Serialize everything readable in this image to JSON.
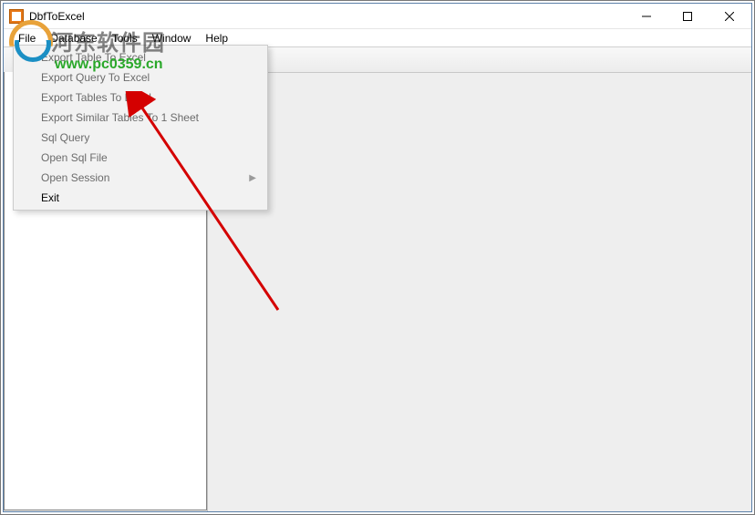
{
  "window": {
    "title": "DbfToExcel"
  },
  "menubar": {
    "items": [
      "File",
      "Database",
      "Tools",
      "Window",
      "Help"
    ]
  },
  "file_menu": {
    "items": [
      {
        "label": "Export Table To Excel",
        "enabled": false,
        "submenu": false
      },
      {
        "label": "Export Query To Excel",
        "enabled": false,
        "submenu": false
      },
      {
        "label": "Export Tables To Excel",
        "enabled": false,
        "submenu": false
      },
      {
        "label": "Export Similar Tables To 1 Sheet",
        "enabled": false,
        "submenu": false
      },
      {
        "label": "Sql Query",
        "enabled": false,
        "submenu": false
      },
      {
        "label": "Open Sql File",
        "enabled": false,
        "submenu": false
      },
      {
        "label": "Open Session",
        "enabled": false,
        "submenu": true
      },
      {
        "label": "Exit",
        "enabled": true,
        "submenu": false
      }
    ]
  },
  "watermark": {
    "text": "河东软件园",
    "url": "www.pc0359.cn"
  }
}
